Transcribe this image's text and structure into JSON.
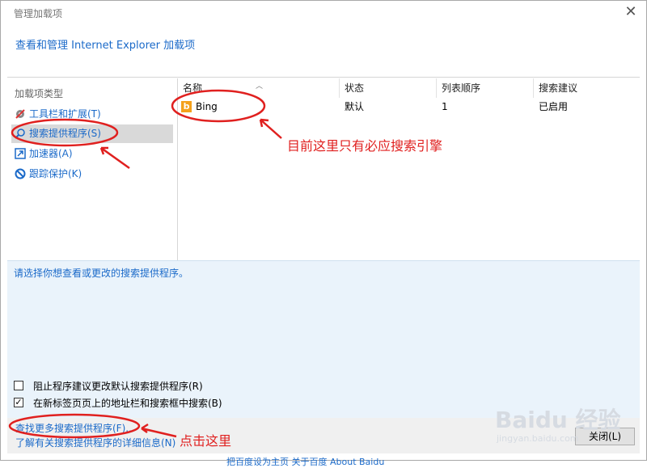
{
  "window": {
    "title": "管理加载项",
    "close_glyph": "✕"
  },
  "header": {
    "link": "查看和管理 Internet Explorer 加载项"
  },
  "sidebar": {
    "heading": "加载项类型",
    "items": [
      {
        "label": "工具栏和扩展(T)",
        "icon": "gear-icon"
      },
      {
        "label": "搜索提供程序(S)",
        "icon": "search-icon",
        "selected": true
      },
      {
        "label": "加速器(A)",
        "icon": "accelerator-icon"
      },
      {
        "label": "跟踪保护(K)",
        "icon": "block-icon"
      }
    ]
  },
  "list": {
    "columns": [
      "名称",
      "状态",
      "列表顺序",
      "搜索建议"
    ],
    "rows": [
      {
        "name": "Bing",
        "status": "默认",
        "order": "1",
        "suggest": "已启用",
        "icon": "bing-icon"
      }
    ]
  },
  "detail": {
    "text": "请选择你想查看或更改的搜索提供程序。",
    "checkboxes": [
      {
        "label": "阻止程序建议更改默认搜索提供程序(R)",
        "checked": false
      },
      {
        "label": "在新标签页页上的地址栏和搜索框中搜索(B)",
        "checked": true
      }
    ]
  },
  "footer": {
    "link_more": "查找更多搜索提供程序(F)...",
    "link_info": "了解有关搜索提供程序的详细信息(N)",
    "close_button": "关闭(L)"
  },
  "background": {
    "links": "把百度设为主页    关于百度    About  Baidu"
  },
  "annotations": {
    "note_only_engine": "目前这里只有必应搜索引擎",
    "note_click_here": "点击这里",
    "color": "#e0201f"
  },
  "watermark": {
    "brand": "Baidu 经验",
    "url": "jingyan.baidu.com"
  }
}
